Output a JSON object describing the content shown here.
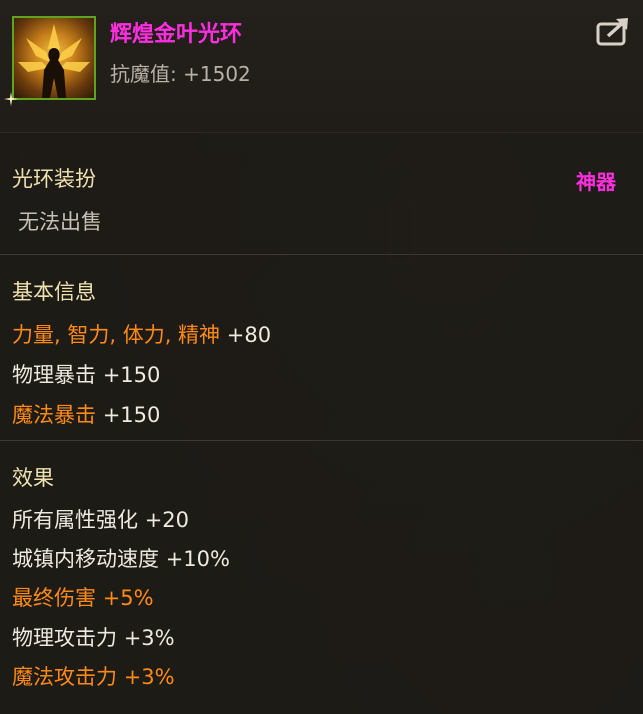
{
  "item": {
    "name": "辉煌金叶光环",
    "resist_label": "抗魔值:",
    "resist_value": "+1502",
    "type": "光环装扮",
    "rarity": "神器",
    "sell_status": "无法出售"
  },
  "basic_info": {
    "title": "基本信息",
    "stats": [
      {
        "label": "力量, 智力, 体力, 精神",
        "value": "+80",
        "label_color": "orange"
      },
      {
        "label": "物理暴击",
        "value": "+150",
        "label_color": "white"
      },
      {
        "label": "魔法暴击",
        "value": "+150",
        "label_color": "orange"
      }
    ]
  },
  "effects": {
    "title": "效果",
    "stats": [
      {
        "label": "所有属性强化",
        "value": "+20",
        "label_color": "white"
      },
      {
        "label": "城镇内移动速度",
        "value": "+10%",
        "label_color": "white"
      },
      {
        "label": "最终伤害",
        "value": "+5%",
        "label_color": "orange"
      },
      {
        "label": "物理攻击力",
        "value": "+3%",
        "label_color": "white"
      },
      {
        "label": "魔法攻击力",
        "value": "+3%",
        "label_color": "orange"
      }
    ]
  },
  "icons": {
    "item": "golden-leaf-aura-icon",
    "share": "share-export-icon",
    "sparkle": "sparkle-icon"
  },
  "colors": {
    "title": "#ff2fe0",
    "orange": "#ff8a17",
    "border": "#5fa31f"
  }
}
